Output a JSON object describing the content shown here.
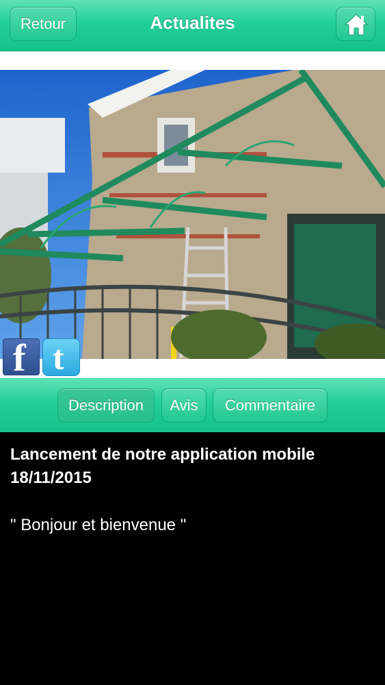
{
  "header": {
    "back_label": "Retour",
    "title": "Actualites",
    "home_icon": "home-icon"
  },
  "photo": {
    "subject": "house with green metal canopy"
  },
  "social": {
    "facebook_glyph": "f",
    "twitter_glyph": "t"
  },
  "tabs": [
    {
      "label": "Description",
      "active": true
    },
    {
      "label": "Avis",
      "active": false
    },
    {
      "label": "Commentaire",
      "active": false
    }
  ],
  "article": {
    "title_line1": "Lancement de notre application mobile",
    "title_line2": "18/11/2015",
    "message": "\" Bonjour et bienvenue \""
  },
  "colors": {
    "accent": "#22cf98",
    "background": "#000000"
  }
}
